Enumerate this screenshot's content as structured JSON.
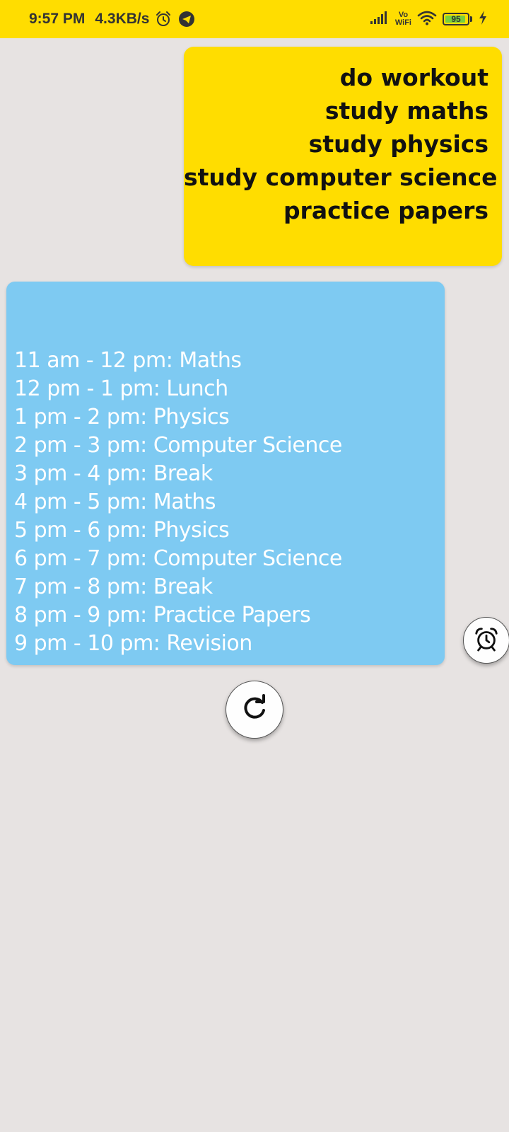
{
  "status_bar": {
    "time": "9:57 PM",
    "net_speed": "4.3KB/s",
    "icons": [
      "alarm-icon",
      "telegram-icon",
      "signal-icon",
      "vowifi-icon",
      "wifi-icon",
      "battery-icon",
      "charging-icon"
    ],
    "vowifi_top": "Vo",
    "vowifi_bottom": "WiFi",
    "battery_level": "95",
    "battery_fraction": 0.95,
    "background": "#ffdd00"
  },
  "tasks": {
    "background": "#ffdd00",
    "items": [
      "do workout",
      "study maths",
      "study physics",
      "study computer science",
      "practice papers"
    ]
  },
  "schedule": {
    "background": "#7ecaf2",
    "items": [
      "11 am - 12 pm: Maths",
      "12 pm - 1 pm: Lunch",
      "1 pm - 2 pm: Physics",
      "2 pm - 3 pm: Computer Science",
      "3 pm - 4 pm: Break",
      "4 pm - 5 pm: Maths",
      "5 pm - 6 pm: Physics",
      "6 pm - 7 pm: Computer Science",
      "7 pm - 8 pm: Break",
      "8 pm - 9 pm: Practice Papers",
      "9 pm - 10 pm: Revision"
    ]
  },
  "actions": {
    "refresh_icon": "refresh-icon",
    "alarm_icon": "alarm-clock-icon"
  }
}
